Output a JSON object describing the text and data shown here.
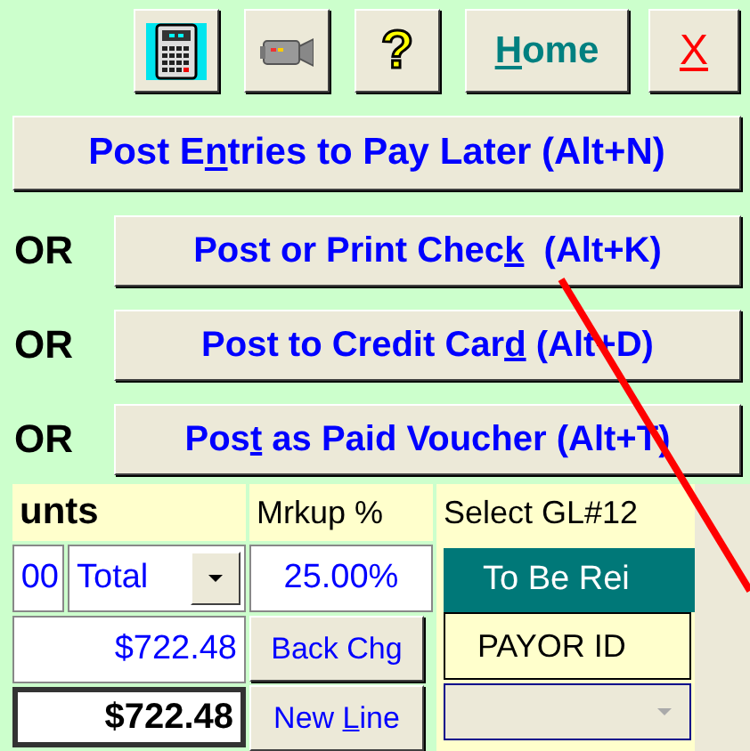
{
  "toolbar": [
    {
      "kind": "calculator"
    },
    {
      "kind": "camera"
    },
    {
      "kind": "help",
      "label": "?"
    },
    {
      "kind": "home",
      "label": {
        "key": "H",
        "after": "ome"
      }
    },
    {
      "kind": "close",
      "label": {
        "key": "X"
      }
    }
  ],
  "primary_action": {
    "label": {
      "before": "Post E",
      "key": "n",
      "after": "tries to Pay Later (Alt+N)"
    }
  },
  "alternatives": [
    {
      "prefix": "OR",
      "label": {
        "before": "Post or Print Chec",
        "key": "k",
        "after": "  (Alt+K)"
      }
    },
    {
      "prefix": "OR",
      "label": {
        "before": "Post to Credit Car",
        "key": "d",
        "after": " (Alt+D)"
      }
    },
    {
      "prefix": "OR",
      "label": {
        "before": "Pos",
        "key": "t",
        "after": " as Paid Voucher (Alt+T)"
      }
    }
  ],
  "entry": {
    "amounts_header": "unts",
    "amount_value": "00",
    "amount_type": "Total",
    "subtotal": "$722.48",
    "total": "$722.48",
    "markup_header": "Mrkup %",
    "markup_value": "25.00%",
    "back_charge_button": {
      "before": "Back Chg"
    },
    "new_line_button": {
      "before": "New ",
      "key": "L",
      "after": "ine"
    },
    "gl_header": "Select GL#12",
    "reimburse_header": "To Be Rei",
    "payor_header": "PAYOR ID",
    "payor_dropdown": {
      "disabled": true
    }
  }
}
